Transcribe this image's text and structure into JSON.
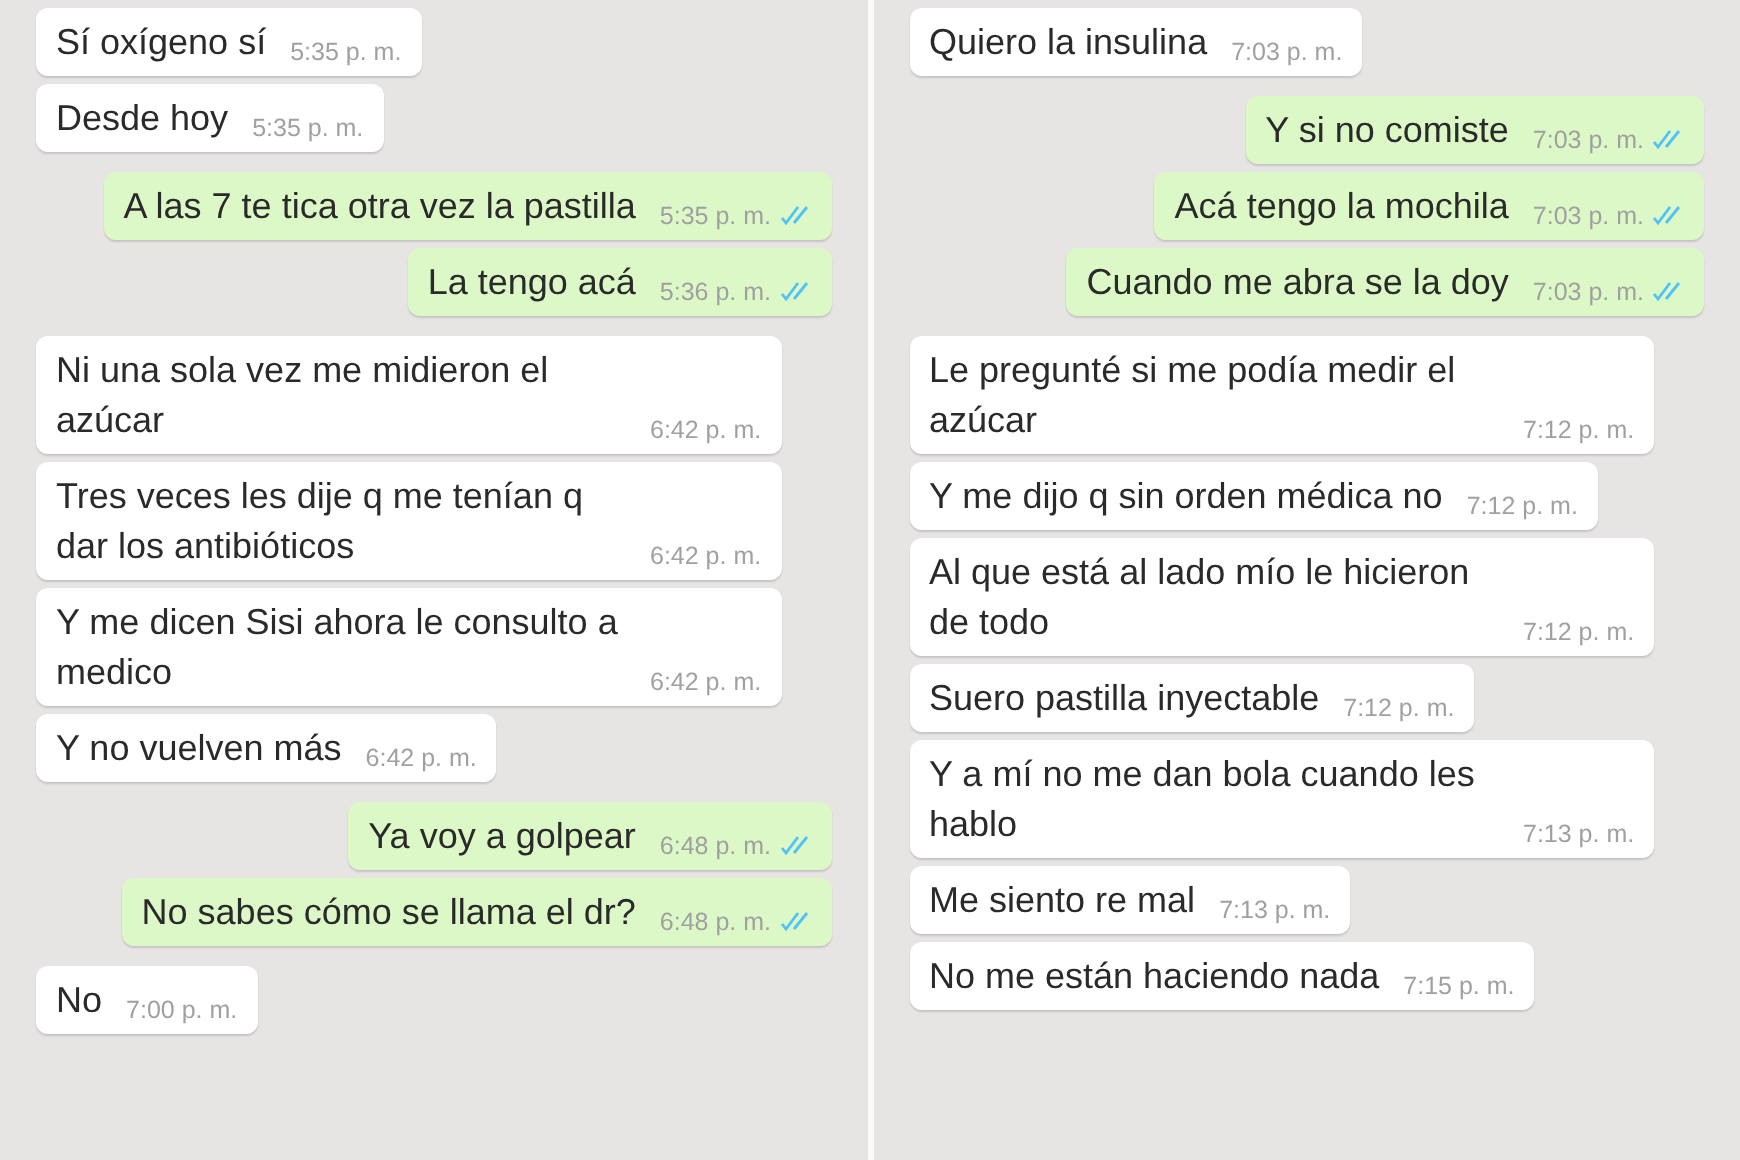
{
  "panels": [
    {
      "messages": [
        {
          "kind": "in",
          "text": "Sí oxígeno sí",
          "time": "5:35 p. m."
        },
        {
          "kind": "in",
          "text": "Desde hoy",
          "time": "5:35 p. m."
        },
        {
          "kind": "out",
          "text": "A las 7 te tica otra vez la pastilla",
          "time": "5:35 p. m.",
          "read": true
        },
        {
          "kind": "out",
          "text": "La tengo acá",
          "time": "5:36 p. m.",
          "read": true
        },
        {
          "kind": "in",
          "text": "Ni una sola vez me midieron el azúcar",
          "time": "6:42 p. m."
        },
        {
          "kind": "in",
          "text": "Tres veces les dije q me tenían q dar los antibióticos",
          "time": "6:42 p. m."
        },
        {
          "kind": "in",
          "text": "Y me dicen Sisi ahora le consulto a medico",
          "time": "6:42 p. m."
        },
        {
          "kind": "in",
          "text": "Y no vuelven más",
          "time": "6:42 p. m."
        },
        {
          "kind": "out",
          "text": "Ya voy a golpear",
          "time": "6:48 p. m.",
          "read": true
        },
        {
          "kind": "out",
          "text": "No sabes cómo se llama el dr?",
          "time": "6:48 p. m.",
          "read": true
        },
        {
          "kind": "in",
          "text": "No",
          "time": "7:00 p. m."
        }
      ]
    },
    {
      "messages": [
        {
          "kind": "in",
          "text": "Quiero la insulina",
          "time": "7:03 p. m."
        },
        {
          "kind": "out",
          "text": "Y si no comiste",
          "time": "7:03 p. m.",
          "read": true
        },
        {
          "kind": "out",
          "text": "Acá tengo la mochila",
          "time": "7:03 p. m.",
          "read": true
        },
        {
          "kind": "out",
          "text": "Cuando me abra se la doy",
          "time": "7:03 p. m.",
          "read": true
        },
        {
          "kind": "in",
          "text": "Le pregunté si me podía medir el azúcar",
          "time": "7:12 p. m."
        },
        {
          "kind": "in",
          "text": "Y me dijo q sin orden médica no",
          "time": "7:12 p. m."
        },
        {
          "kind": "in",
          "text": "Al que está al lado mío le hicieron de todo",
          "time": "7:12 p. m."
        },
        {
          "kind": "in",
          "text": "Suero pastilla inyectable",
          "time": "7:12 p. m."
        },
        {
          "kind": "in",
          "text": "Y a mí no me dan bola cuando les hablo",
          "time": "7:13 p. m."
        },
        {
          "kind": "in",
          "text": "Me siento re mal",
          "time": "7:13 p. m."
        },
        {
          "kind": "in",
          "text": "No me están haciendo nada",
          "time": "7:15 p. m."
        }
      ]
    }
  ]
}
